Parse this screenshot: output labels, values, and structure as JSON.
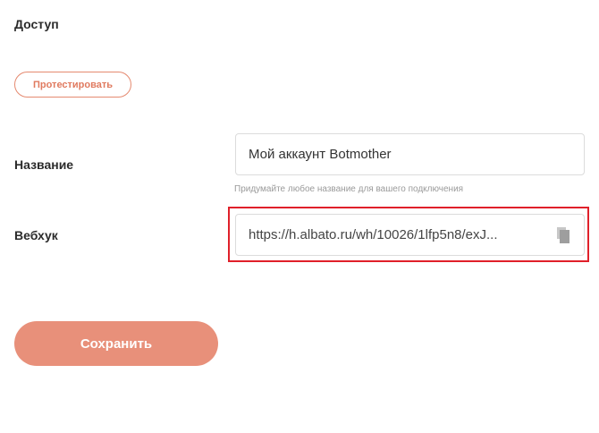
{
  "access": {
    "title": "Доступ",
    "test_button_label": "Протестировать"
  },
  "name_field": {
    "label": "Название",
    "value": "Мой аккаунт Botmother",
    "hint": "Придумайте любое название для вашего подключения"
  },
  "webhook_field": {
    "label": "Вебхук",
    "value": "https://h.albato.ru/wh/10026/1lfp5n8/exJ...",
    "copy_icon": "copy-icon"
  },
  "save_button_label": "Сохранить",
  "colors": {
    "accent": "#e8907a",
    "accent_border": "#e58a70",
    "highlight": "#e0202a"
  }
}
